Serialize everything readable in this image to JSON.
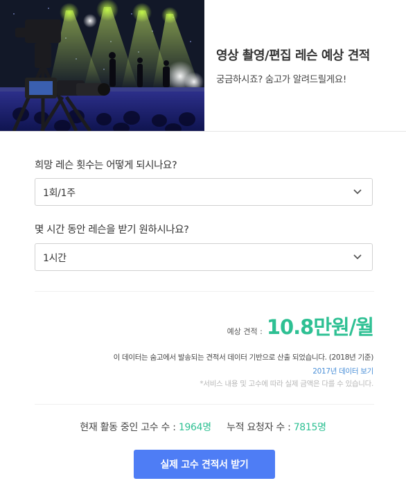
{
  "header": {
    "title": "영상 촬영/편집 레슨 예상 견적",
    "subtitle": "궁금하시죠? 숨고가 알려드릴게요!"
  },
  "form": {
    "frequency_question": "희망 레슨 횟수는 어떻게 되시나요?",
    "frequency_value": "1회/1주",
    "duration_question": "몇 시간 동안 레슨을 받기 원하시나요?",
    "duration_value": "1시간"
  },
  "estimate": {
    "label": "예상 견적 :",
    "price": "10.8만원/월",
    "source_note": "이 데이터는 숨고에서 발송되는 견적서 데이터 기반으로 산출 되었습니다. (2018년 기준)",
    "link_text": "2017년 데이터 보기",
    "disclaimer": "*서비스 내용 및 고수에 따라 실제 금액은 다를 수 있습니다."
  },
  "stats": {
    "active_label": "현재 활동 중인 고수 수 :",
    "active_count": "1964명",
    "requests_label": "누적 요청자 수 :",
    "requests_count": "7815명"
  },
  "cta": {
    "label": "실제 고수 견적서 받기"
  },
  "colors": {
    "accent_green": "#2ec093",
    "button_blue": "#4e7df5",
    "link_blue": "#4a8fd8"
  },
  "icons": {
    "select_arrow": "chevron-down-icon"
  }
}
